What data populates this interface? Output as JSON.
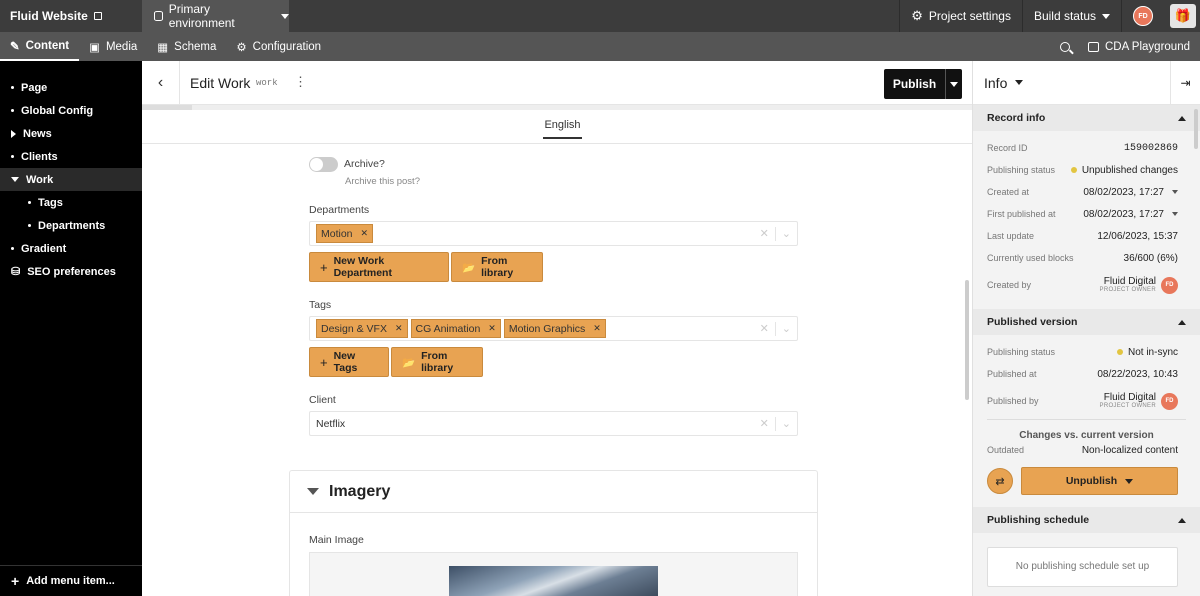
{
  "app": {
    "site_name": "Fluid Website",
    "environment": "Primary environment",
    "project_settings": "Project settings",
    "build_status": "Build status",
    "avatar_initials": "FD"
  },
  "nav": {
    "tabs": [
      {
        "label": "Content",
        "icon": "edit-icon",
        "active": true
      },
      {
        "label": "Media",
        "icon": "image-icon"
      },
      {
        "label": "Schema",
        "icon": "schema-icon"
      },
      {
        "label": "Configuration",
        "icon": "configuration-icon"
      }
    ],
    "cda_playground": "CDA Playground"
  },
  "sidebar": {
    "items": [
      {
        "label": "Page"
      },
      {
        "label": "Global Config"
      },
      {
        "label": "News"
      },
      {
        "label": "Clients"
      },
      {
        "label": "Work"
      },
      {
        "label": "Tags"
      },
      {
        "label": "Departments"
      },
      {
        "label": "Gradient"
      },
      {
        "label": "SEO preferences"
      }
    ],
    "add_menu_item": "Add menu item..."
  },
  "editor": {
    "title": "Edit Work",
    "api_key": "work",
    "publish_label": "Publish",
    "locale_tab": "English",
    "archive": {
      "label": "Archive?",
      "hint": "Archive this post?"
    },
    "departments": {
      "label": "Departments",
      "chips": [
        "Motion"
      ],
      "new_button": "New Work Department",
      "library_button": "From library"
    },
    "tags": {
      "label": "Tags",
      "chips": [
        "Design & VFX",
        "CG Animation",
        "Motion Graphics"
      ],
      "new_button": "New Tags",
      "library_button": "From library"
    },
    "client": {
      "label": "Client",
      "value": "Netflix"
    },
    "imagery": {
      "title": "Imagery",
      "main_image_label": "Main Image"
    }
  },
  "info_panel": {
    "title": "Info",
    "record_info": {
      "title": "Record info",
      "rows": [
        {
          "label": "Record ID",
          "value": "159002869"
        },
        {
          "label": "Publishing status",
          "value": "Unpublished changes"
        },
        {
          "label": "Created at",
          "value": "08/02/2023, 17:27"
        },
        {
          "label": "First published at",
          "value": "08/02/2023, 17:27"
        },
        {
          "label": "Last update",
          "value": "12/06/2023, 15:37"
        },
        {
          "label": "Currently used blocks",
          "value": "36/600 (6%)"
        },
        {
          "label": "Created by",
          "name": "Fluid Digital",
          "role": "PROJECT OWNER",
          "initials": "FD"
        }
      ]
    },
    "published_version": {
      "title": "Published version",
      "rows": [
        {
          "label": "Publishing status",
          "value": "Not in-sync"
        },
        {
          "label": "Published at",
          "value": "08/22/2023, 10:43"
        },
        {
          "label": "Published by",
          "name": "Fluid Digital",
          "role": "PROJECT OWNER",
          "initials": "FD"
        }
      ],
      "changes_title": "Changes vs. current version",
      "outdated_label": "Outdated",
      "outdated_value": "Non-localized content",
      "unpublish_label": "Unpublish"
    },
    "schedule": {
      "title": "Publishing schedule",
      "empty": "No publishing schedule set up"
    }
  },
  "colors": {
    "accent": "#e8a352",
    "status_dot": "#e2c541",
    "avatar": "#e8775b"
  }
}
